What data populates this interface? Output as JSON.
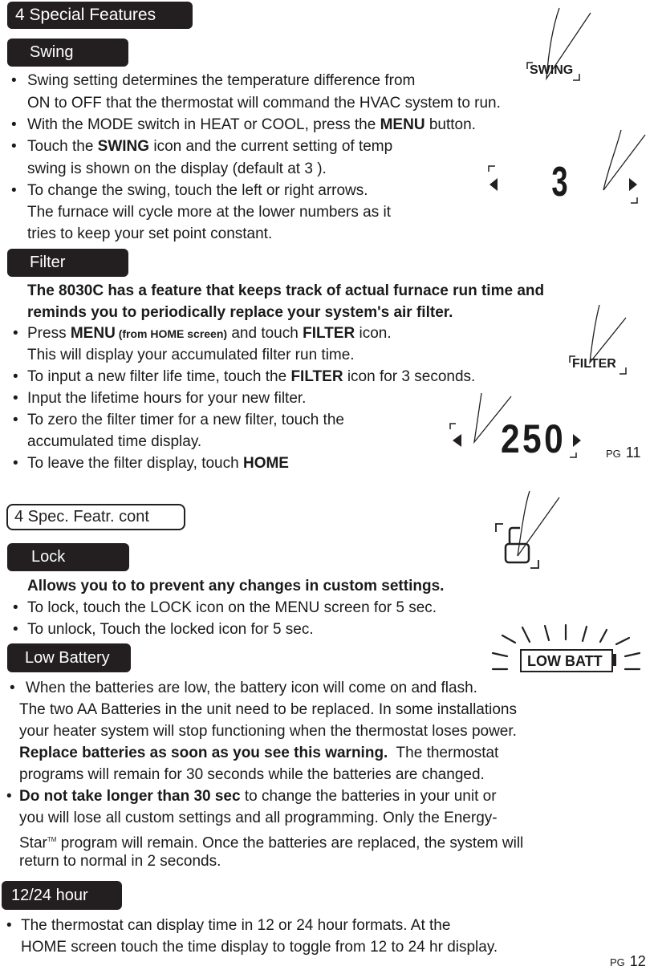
{
  "page11": {
    "section_header": "4  Special  Features",
    "page_label": "PG",
    "page_number": "11",
    "swing": {
      "title": "Swing",
      "icon_label": "SWING",
      "display_value": "3",
      "lines": [
        "Swing setting determines the temperature difference from",
        "ON to OFF that the thermostat will command the HVAC system to run.",
        "With the MODE switch in HEAT or COOL, press the ",
        "MENU",
        " button.",
        "Touch the ",
        "SWING",
        " icon and the current setting of temp",
        "swing is shown on the display (default at 3 ).",
        "To change the swing, touch the left or right arrows.",
        "The furnace will cycle more at the lower numbers as it",
        "tries to keep your set point constant."
      ]
    },
    "filter": {
      "title": "Filter",
      "icon_label": "FILTER",
      "display_value": "250",
      "intro_1": "The 8030C has a feature that keeps track of actual furnace run time and",
      "intro_2": "reminds you to periodically replace your system's air filter.",
      "l1_a": "Press ",
      "l1_b": "MENU",
      "l1_c": " (from HOME screen)",
      "l1_d": " and touch ",
      "l1_e": "FILTER",
      "l1_f": " icon.",
      "l2": "This will display your accumulated filter run time.",
      "l3_a": "To input a new filter life time, touch the ",
      "l3_b": "FILTER",
      "l3_c": " icon for 3 seconds.",
      "l4": "Input the lifetime hours for your new filter.",
      "l5": "To zero the filter timer for a new filter, touch the",
      "l6": "accumulated time display.",
      "l7_a": "To leave the filter display, touch ",
      "l7_b": "HOME"
    }
  },
  "page12": {
    "section_header": "4  Spec. Featr. cont",
    "page_label": "PG",
    "page_number": "12",
    "lock": {
      "title": "Lock",
      "intro": "Allows you to to prevent any changes in custom settings.",
      "l1": "To lock, touch the LOCK icon on the MENU screen for 5 sec.",
      "l2": "To unlock, Touch the locked icon for 5 sec."
    },
    "low_battery": {
      "title": "Low Battery",
      "icon_label": "LOW BATT",
      "l1": "When the batteries are low, the battery icon will come on and flash.",
      "l2": "The two AA Batteries in the unit need to be replaced.  In some installations",
      "l3": "your heater system will stop functioning when the thermostat loses power.",
      "l4_a": "Replace batteries as soon as you see this warning.",
      "l4_b": "  The thermostat",
      "l5": "programs will remain for 30 seconds while the batteries are changed.",
      "l6_a": "Do not take longer than 30 sec",
      "l6_b": " to change the batteries in your unit or",
      "l7": "you will lose all custom settings and all programming. Only the Energy-",
      "l8_a": "Star",
      "l8_tm": "TM",
      "l8_b": " program will remain. Once the batteries are replaced, the system will",
      "l9": "return to normal in 2 seconds."
    },
    "hour_format": {
      "title": "12/24 hour",
      "l1": "The thermostat can display time in 12 or 24 hour formats. At the",
      "l2": "HOME screen touch the time display to toggle from 12 to 24 hr display."
    }
  },
  "bullet": "•"
}
